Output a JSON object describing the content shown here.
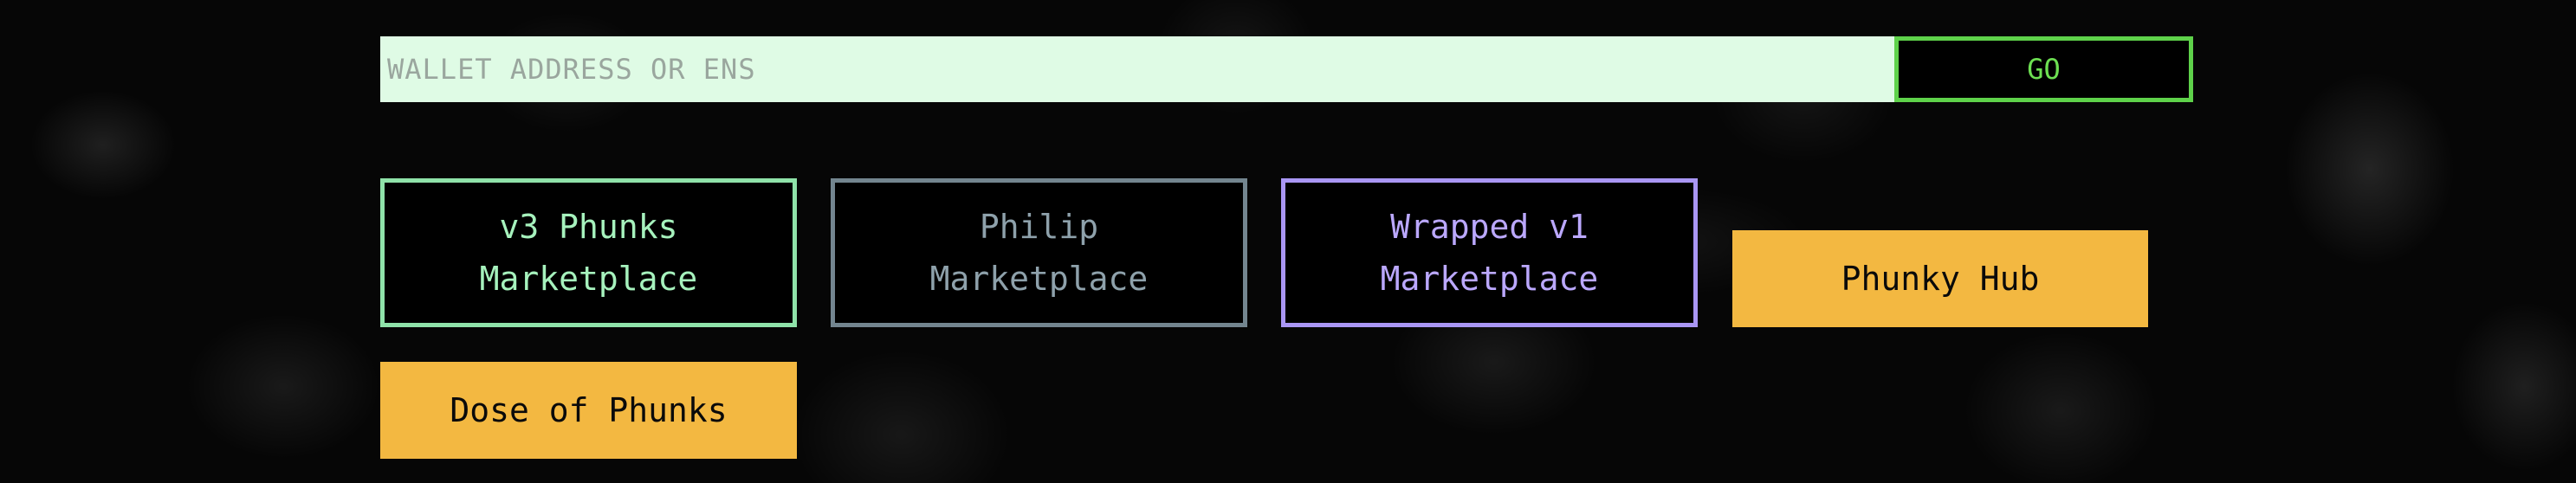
{
  "search": {
    "placeholder": "WALLET ADDRESS OR ENS",
    "value": "",
    "go_label": "GO"
  },
  "nav": {
    "v3_marketplace": {
      "line1": "v3 Phunks",
      "line2": "Marketplace",
      "color": "#a6f2bd"
    },
    "philip_marketplace": {
      "line1": "Philip",
      "line2": "Marketplace",
      "color": "#8ea1ab"
    },
    "wrapped_v1_marketplace": {
      "line1": "Wrapped v1",
      "line2": "Marketplace",
      "color": "#bba8ff"
    },
    "phunky_hub": {
      "label": "Phunky Hub",
      "color": "#f3b841"
    },
    "dose_of_phunks": {
      "label": "Dose of Phunks",
      "color": "#f3b841"
    }
  },
  "colors": {
    "input_bg": "#dffbe5",
    "go_accent": "#5ed24a",
    "background": "#060606"
  }
}
